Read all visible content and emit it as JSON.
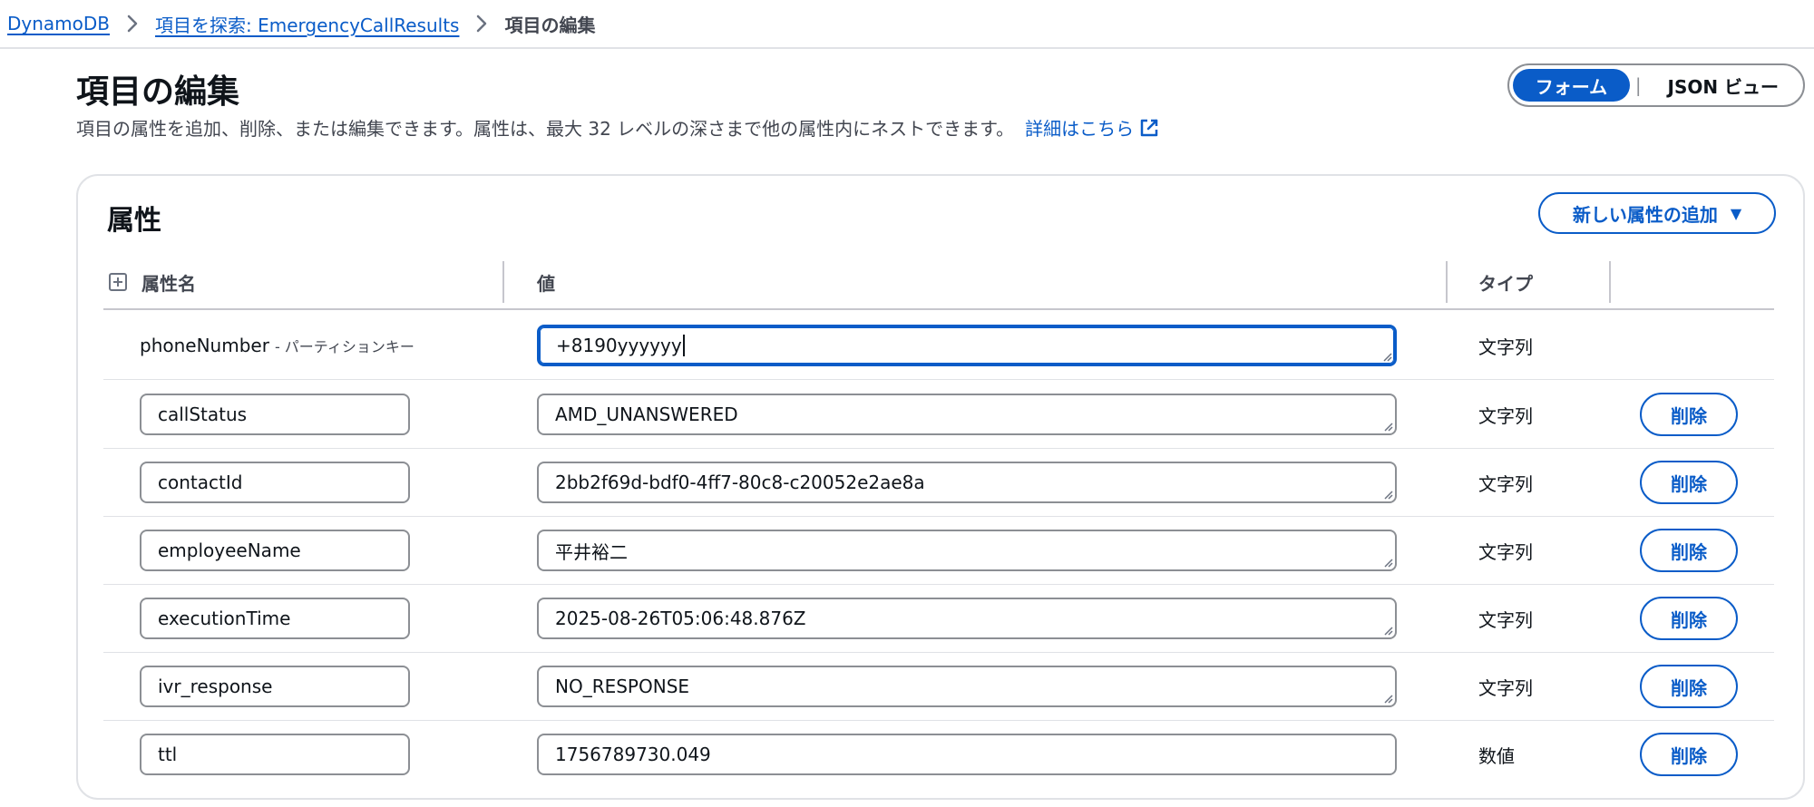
{
  "breadcrumb": {
    "items": [
      "DynamoDB",
      "項目を探索: EmergencyCallResults"
    ],
    "current": "項目の編集"
  },
  "page": {
    "title": "項目の編集",
    "description": "項目の属性を追加、削除、または編集できます。属性は、最大 32 レベルの深さまで他の属性内にネストできます。",
    "learn_more": "詳細はこちら"
  },
  "view_toggle": {
    "form": "フォーム",
    "json": "JSON ビュー",
    "selected": "form"
  },
  "attributes": {
    "title": "属性",
    "add_button": "新しい属性の追加",
    "columns": {
      "name": "属性名",
      "value": "値",
      "type": "タイプ"
    },
    "partition_key": {
      "name": "phoneNumber",
      "suffix": "- パーティションキー",
      "value": "+8190yyyyyy",
      "type": "文字列"
    },
    "rows": [
      {
        "name": "callStatus",
        "value": "AMD_UNANSWERED",
        "type": "文字列",
        "delete": "削除"
      },
      {
        "name": "contactId",
        "value": "2bb2f69d-bdf0-4ff7-80c8-c20052e2ae8a",
        "type": "文字列",
        "delete": "削除"
      },
      {
        "name": "employeeName",
        "value": "平井裕二",
        "type": "文字列",
        "delete": "削除"
      },
      {
        "name": "executionTime",
        "value": "2025-08-26T05:06:48.876Z",
        "type": "文字列",
        "delete": "削除"
      },
      {
        "name": "ivr_response",
        "value": "NO_RESPONSE",
        "type": "文字列",
        "delete": "削除"
      },
      {
        "name": "ttl",
        "value": "1756789730.049",
        "type": "数値",
        "delete": "削除"
      }
    ]
  },
  "colors": {
    "accent": "#0a5cc8",
    "border": "#8c8f94",
    "text": "#0f141a"
  }
}
